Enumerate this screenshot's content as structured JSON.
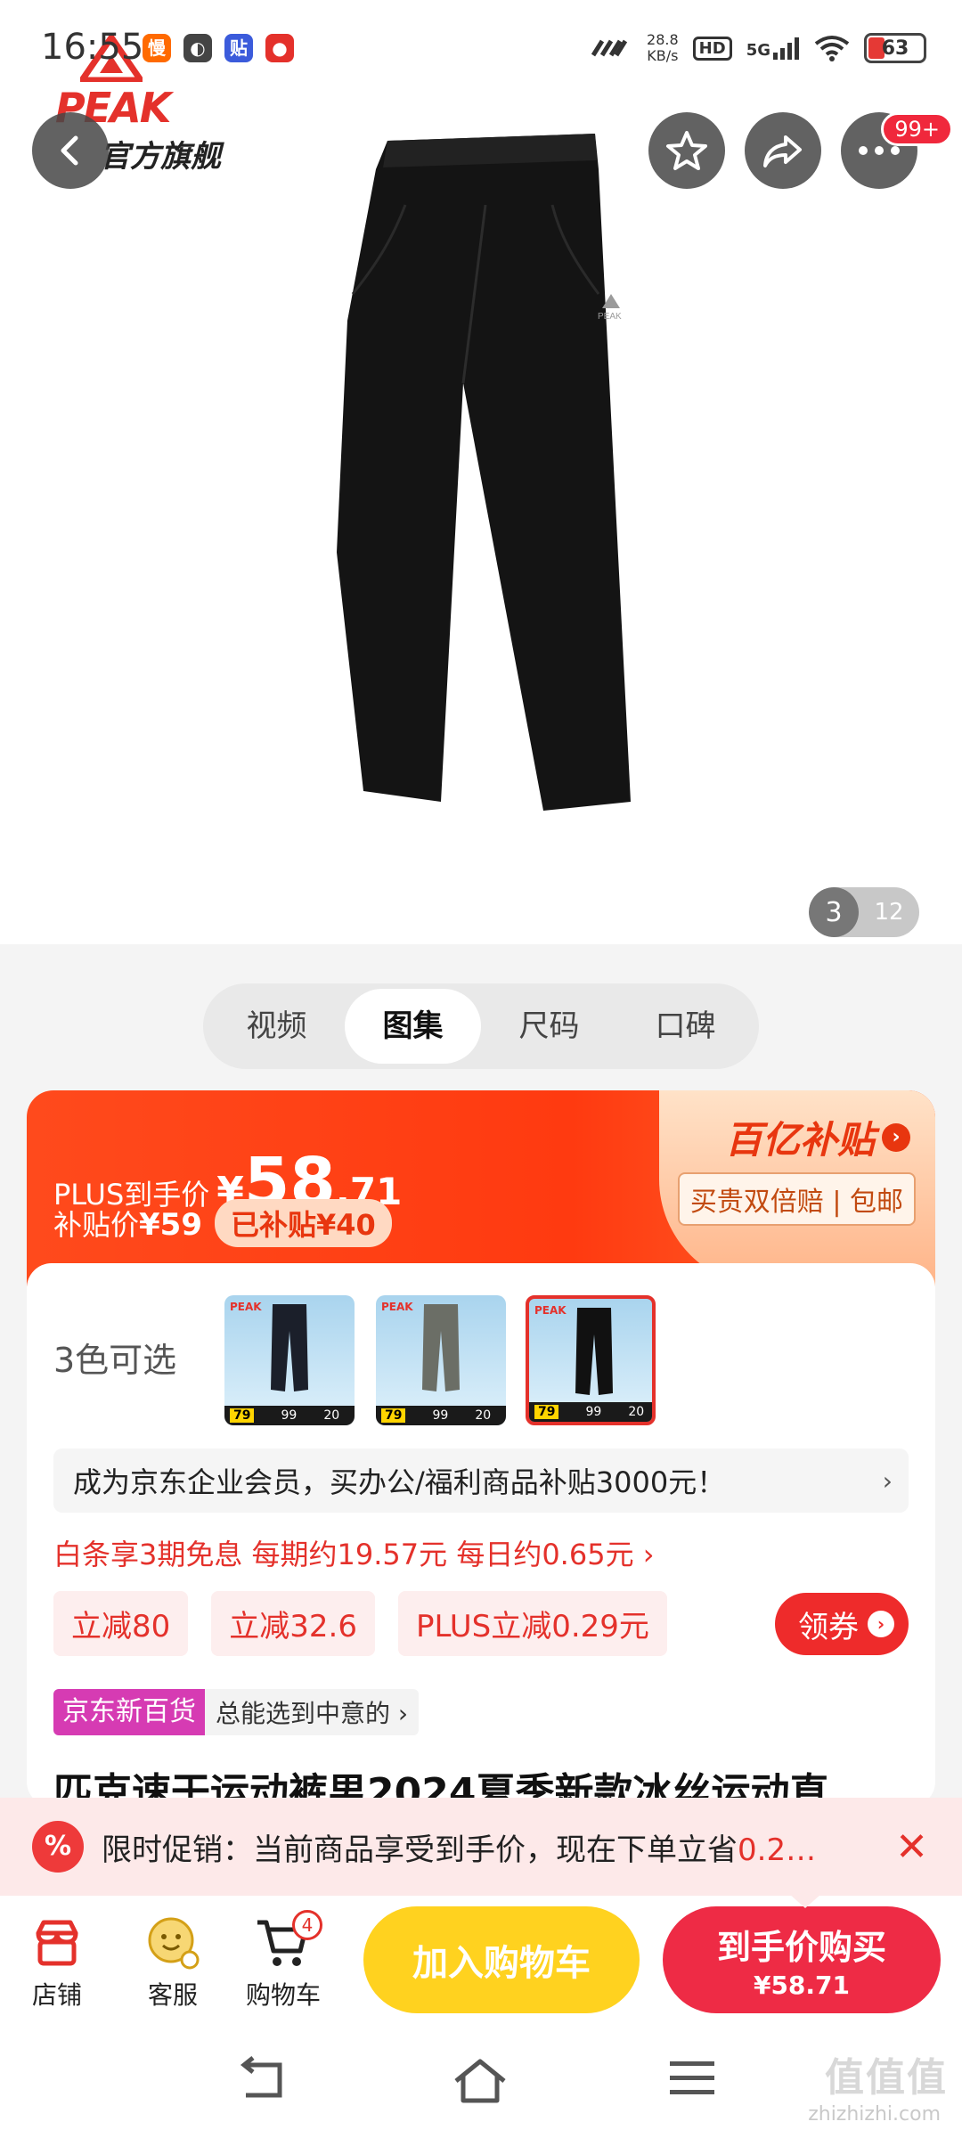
{
  "status_bar": {
    "time": "16:55",
    "app_icons": [
      {
        "name": "slow-app-icon",
        "glyph": "慢",
        "color": "#ff6a00"
      },
      {
        "name": "leaf-app-icon",
        "glyph": "◐",
        "color": "#444444"
      },
      {
        "name": "tie-app-icon",
        "glyph": "贴",
        "color": "#3b5bdb"
      },
      {
        "name": "mascot-app-icon",
        "glyph": "●",
        "color": "#e4312b"
      }
    ],
    "speed_value": "28.8",
    "speed_unit": "KB/s",
    "hd": "HD",
    "network": "5G",
    "battery": "63"
  },
  "header": {
    "brand_logo": "PEAK",
    "brand_store": "官方旗舰",
    "notification_badge": "99+"
  },
  "gallery": {
    "current": "3",
    "total": "12"
  },
  "tabs": [
    {
      "label": "视频",
      "active": false
    },
    {
      "label": "图集",
      "active": true
    },
    {
      "label": "尺码",
      "active": false
    },
    {
      "label": "口碑",
      "active": false
    }
  ],
  "price": {
    "plus_label": "PLUS到手价",
    "currency": "¥",
    "integer": "58",
    "decimal": ".71",
    "subsidy_label": "补贴价",
    "subsidy_price": "¥59",
    "subsidized": "已补贴¥40",
    "campaign": "百亿补贴",
    "campaign_tags": "买贵双倍赔 | 包邮"
  },
  "colors": {
    "label": "3色可选",
    "swatches": [
      {
        "name": "black-blue",
        "pants": "#1b1f2a",
        "price": "79"
      },
      {
        "name": "gray",
        "pants": "#6b6e66",
        "price": "79"
      },
      {
        "name": "black",
        "pants": "#111111",
        "price": "79"
      }
    ],
    "swatch_brand": "PEAK",
    "strip_a": "99",
    "strip_b": "20"
  },
  "promos": {
    "enterprise": "成为京东企业会员，买办公/福利商品补贴3000元！",
    "baitiao": "白条享3期免息 每期约19.57元 每日约0.65元 ›",
    "coupons": [
      "立减80",
      "立减32.6",
      "PLUS立减0.29元"
    ],
    "get_coupon": "领券",
    "dept_tag": "京东新百货",
    "dept_text": "总能选到中意的 ›"
  },
  "product_title": "匹克速干运动裤男2024夏季新款冰丝运动直",
  "limited_promo": {
    "icon": "%",
    "text_prefix": "限时促销：当前商品享受到手价，现在下单立省",
    "text_highlight": "0.2…",
    "close": "✕"
  },
  "bottom_bar": {
    "store": "店铺",
    "service": "客服",
    "cart": "购物车",
    "cart_count": "4",
    "add_to_cart": "加入购物车",
    "buy_label": "到手价购买",
    "buy_price": "¥58.71"
  },
  "watermark": {
    "big": "值值值",
    "small": "zhizhizhi.com"
  },
  "colors_theme": {
    "jd_red": "#e4312b",
    "orange": "#ff4a1c",
    "yellow": "#ffd21f",
    "buy_red": "#ee2b45"
  }
}
